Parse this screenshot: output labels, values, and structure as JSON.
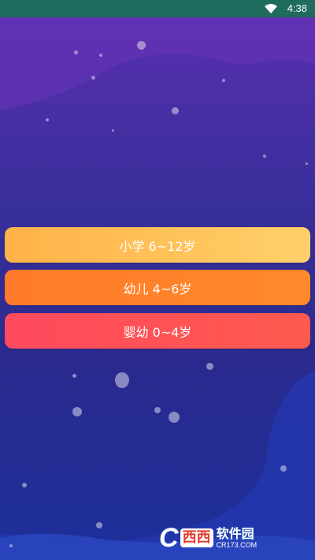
{
  "status_bar": {
    "time": "4:38",
    "wifi_icon": "wifi-icon"
  },
  "age_options": [
    {
      "label": "小学 6~12岁",
      "color_start": "#ffb247",
      "color_end": "#ffd06a"
    },
    {
      "label": "幼儿 4~6岁",
      "color_start": "#ff7a2a",
      "color_end": "#ff8a2a"
    },
    {
      "label": "婴幼 0~4岁",
      "color_start": "#ff4a5e",
      "color_end": "#ff5a4e"
    }
  ],
  "watermark": {
    "letter": "C",
    "brand_red": "西西",
    "brand_name": "软件园",
    "domain": "CR173.COM"
  },
  "colors": {
    "status_bar": "#1f6b5e",
    "background_top": "#5a2fb0",
    "background_bottom": "#1d2f9a"
  }
}
